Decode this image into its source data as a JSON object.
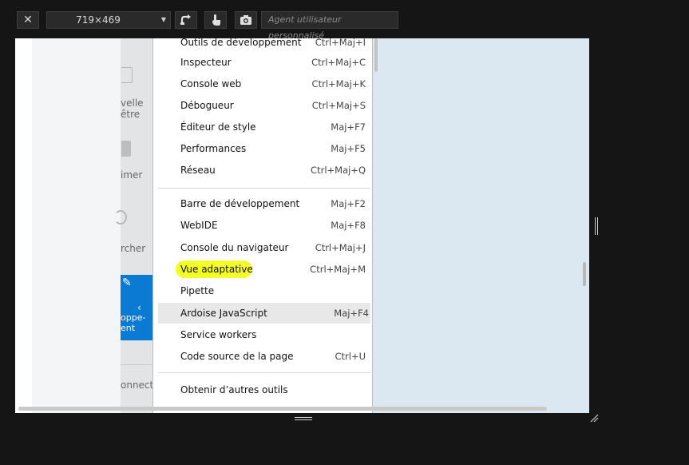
{
  "toolbar": {
    "close_glyph": "✕",
    "viewport_size": "719×469",
    "dropdown_glyph": "▼",
    "ua_placeholder": "Agent utilisateur personnalisé",
    "icons": [
      "close-icon",
      "chevron-down-icon",
      "rotate-icon",
      "touch-icon",
      "camera-icon"
    ]
  },
  "page": {
    "stub_labels": [
      "velle",
      "être",
      "imer",
      "rcher",
      "oppe-",
      "ent",
      "onnect"
    ],
    "blue_accent": "#0b7ad3"
  },
  "menu": {
    "items": [
      {
        "label": "Outils de développement",
        "shortcut": "Ctrl+Maj+I"
      },
      {
        "label": "Inspecteur",
        "shortcut": "Ctrl+Maj+C"
      },
      {
        "label": "Console web",
        "shortcut": "Ctrl+Maj+K"
      },
      {
        "label": "Débogueur",
        "shortcut": "Ctrl+Maj+S"
      },
      {
        "label": "Éditeur de style",
        "shortcut": "Maj+F7"
      },
      {
        "label": "Performances",
        "shortcut": "Maj+F5"
      },
      {
        "label": "Réseau",
        "shortcut": "Ctrl+Maj+Q"
      },
      {
        "label": "Barre de développement",
        "shortcut": "Maj+F2"
      },
      {
        "label": "WebIDE",
        "shortcut": "Maj+F8"
      },
      {
        "label": "Console du navigateur",
        "shortcut": "Ctrl+Maj+J"
      },
      {
        "label": "Vue adaptative",
        "shortcut": "Ctrl+Maj+M"
      },
      {
        "label": "Pipette",
        "shortcut": ""
      },
      {
        "label": "Ardoise JavaScript",
        "shortcut": "Maj+F4"
      },
      {
        "label": "Service workers",
        "shortcut": ""
      },
      {
        "label": "Code source de la page",
        "shortcut": "Ctrl+U"
      },
      {
        "label": "Obtenir d’autres outils",
        "shortcut": ""
      }
    ],
    "highlight_color": "#f4ff2a",
    "hover_color": "#e8e8e8"
  }
}
